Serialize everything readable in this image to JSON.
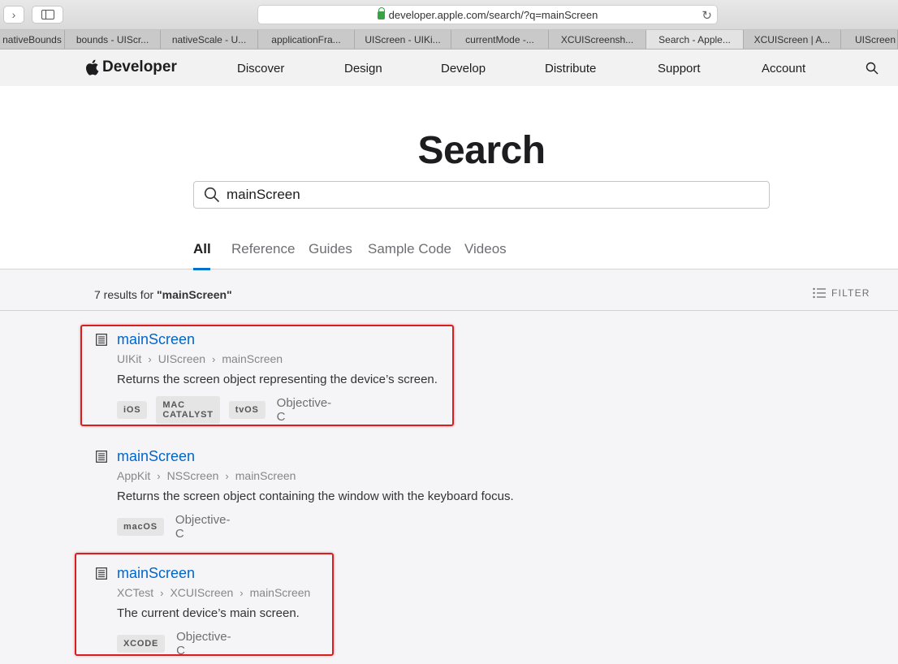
{
  "browser": {
    "url": "developer.apple.com/search/?q=mainScreen",
    "tabs": [
      {
        "label": "nativeBounds",
        "active": false
      },
      {
        "label": "bounds - UIScr...",
        "active": false
      },
      {
        "label": "nativeScale - U...",
        "active": false
      },
      {
        "label": "applicationFra...",
        "active": false
      },
      {
        "label": "UIScreen - UIKi...",
        "active": false
      },
      {
        "label": "currentMode -...",
        "active": false
      },
      {
        "label": "XCUIScreensh...",
        "active": false
      },
      {
        "label": "Search - Apple...",
        "active": true
      },
      {
        "label": "XCUIScreen | A...",
        "active": false
      },
      {
        "label": "UIScreen",
        "active": false
      }
    ]
  },
  "nav": {
    "brand": "Developer",
    "items": [
      "Discover",
      "Design",
      "Develop",
      "Distribute",
      "Support",
      "Account"
    ]
  },
  "search": {
    "title": "Search",
    "query": "mainScreen",
    "scopes": [
      "All",
      "Reference",
      "Guides",
      "Sample Code",
      "Videos"
    ],
    "active_scope": "All"
  },
  "results_header": {
    "count_prefix": "7 results for ",
    "count_query": "\"mainScreen\"",
    "filter_label": "FILTER"
  },
  "results": [
    {
      "title": "mainScreen",
      "path": [
        "UIKit",
        "UIScreen",
        "mainScreen"
      ],
      "description": "Returns the screen object representing the device’s screen.",
      "tags": [
        "iOS",
        "MAC CATALYST",
        "tvOS"
      ],
      "language": "Objective-C",
      "highlighted": true
    },
    {
      "title": "mainScreen",
      "path": [
        "AppKit",
        "NSScreen",
        "mainScreen"
      ],
      "description": "Returns the screen object containing the window with the keyboard focus.",
      "tags": [
        "macOS"
      ],
      "language": "Objective-C",
      "highlighted": false
    },
    {
      "title": "mainScreen",
      "path": [
        "XCTest",
        "XCUIScreen",
        "mainScreen"
      ],
      "description": "The current device’s main screen.",
      "tags": [
        "XCODE"
      ],
      "language": "Objective-C",
      "highlighted": true
    }
  ],
  "colors": {
    "link": "#0066cc",
    "accent": "#0070c9",
    "highlight": "#d81e1e"
  }
}
